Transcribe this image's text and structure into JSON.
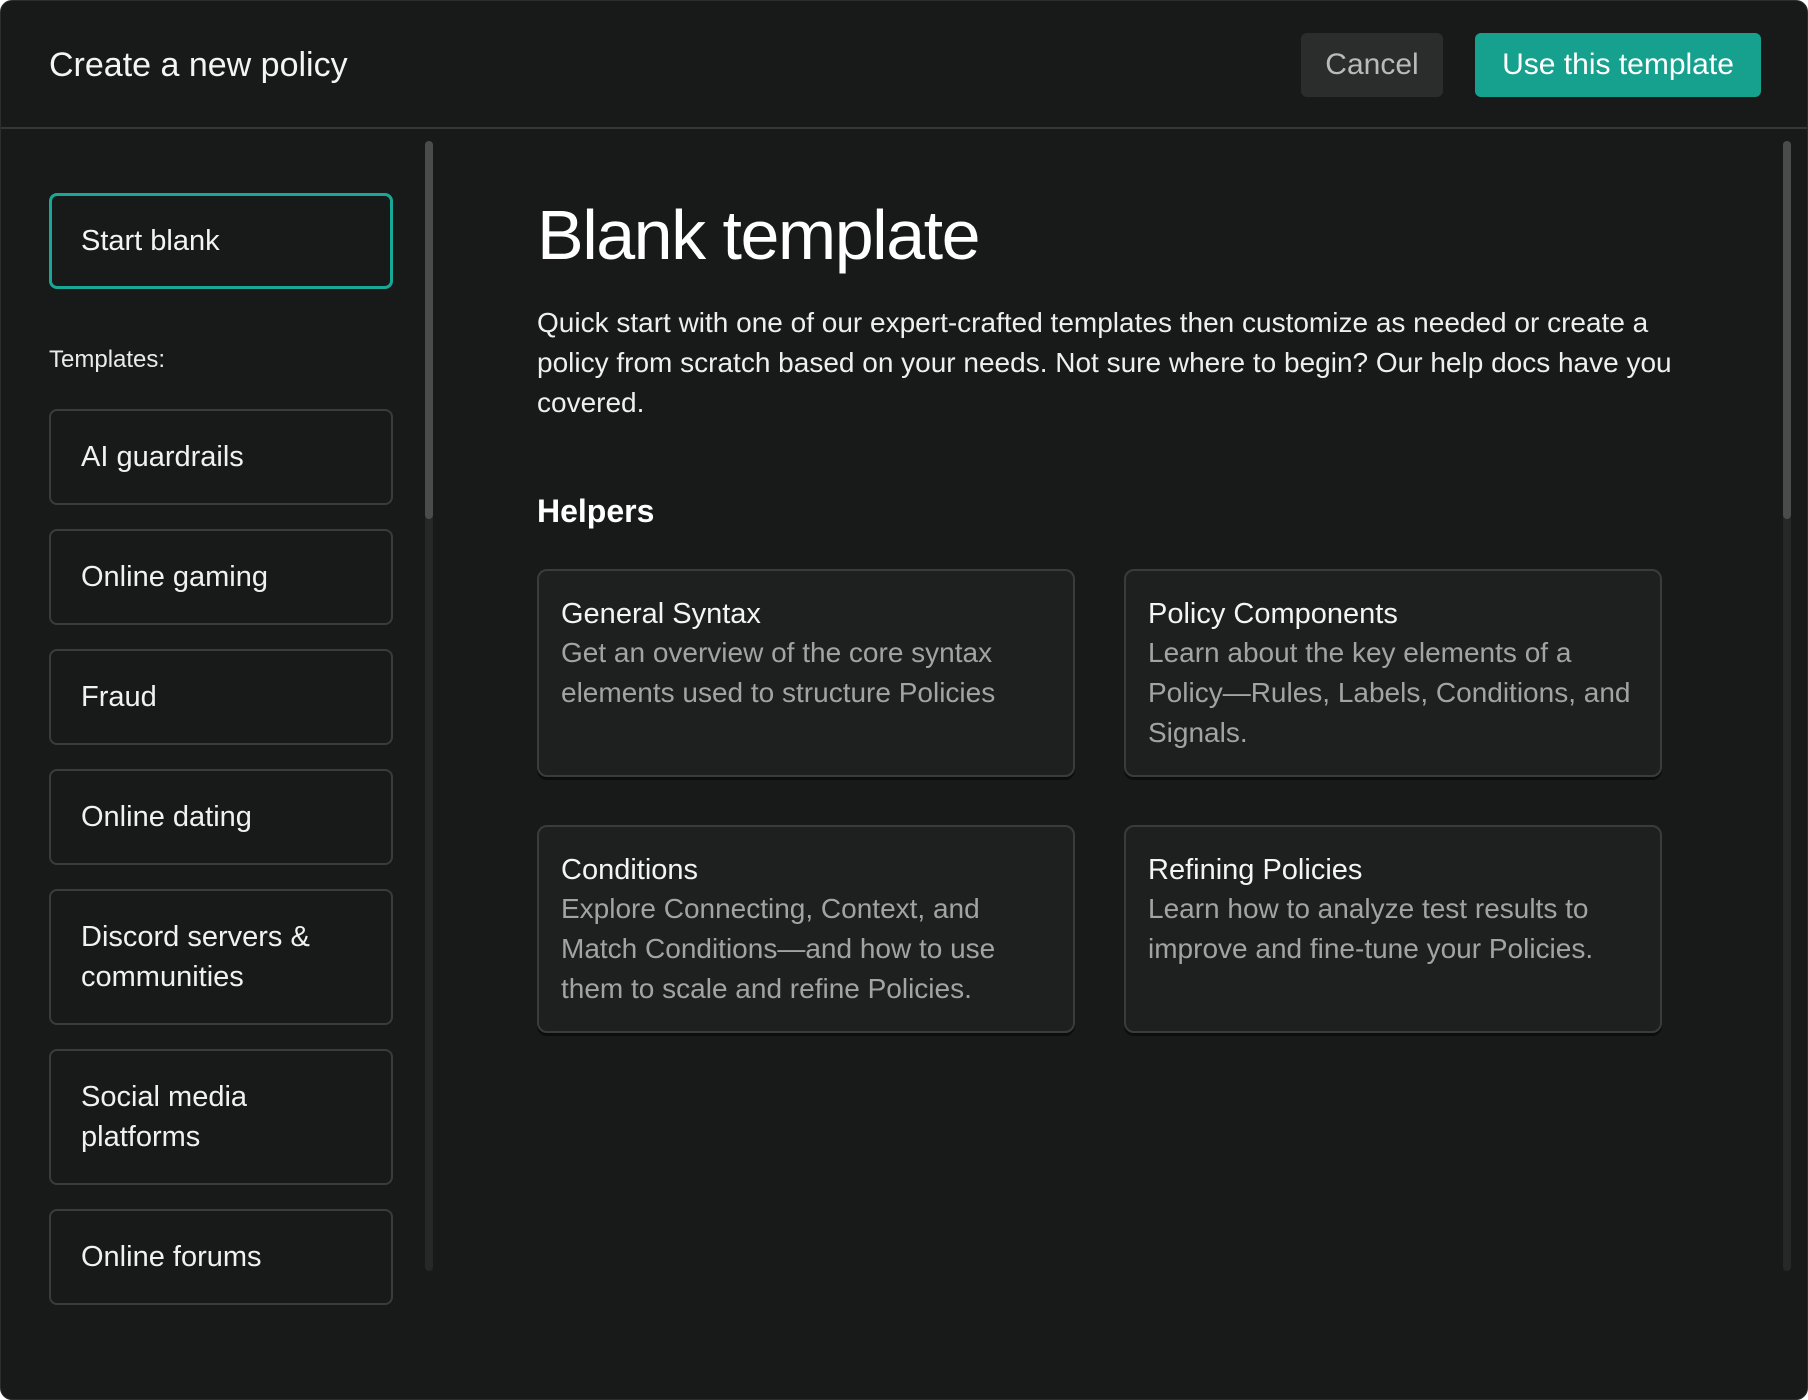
{
  "header": {
    "title": "Create a new policy",
    "cancel_label": "Cancel",
    "primary_label": "Use this template"
  },
  "sidebar": {
    "start_blank_label": "Start blank",
    "templates_label": "Templates:",
    "items": [
      {
        "label": "AI guardrails"
      },
      {
        "label": "Online gaming"
      },
      {
        "label": "Fraud"
      },
      {
        "label": "Online dating"
      },
      {
        "label": "Discord servers & communities"
      },
      {
        "label": "Social media platforms"
      },
      {
        "label": "Online forums"
      }
    ]
  },
  "main": {
    "title": "Blank template",
    "description": "Quick start with one of our expert-crafted templates then customize as needed or create a policy from scratch based on your needs. Not sure where to begin? Our help docs have you covered.",
    "helpers_heading": "Helpers",
    "helpers": [
      {
        "title": "General Syntax",
        "description": "Get an overview of the core syntax elements used to structure Policies"
      },
      {
        "title": "Policy Components",
        "description": "Learn about the key elements of a Policy—Rules, Labels, Conditions, and Signals."
      },
      {
        "title": "Conditions",
        "description": "Explore Connecting, Context, and Match Conditions—and how to use them to scale and refine Policies."
      },
      {
        "title": "Refining Policies",
        "description": "Learn how to analyze test results to improve and fine-tune your Policies."
      }
    ]
  },
  "colors": {
    "background": "#181a19",
    "accent": "#16a18f",
    "selected_border": "#17a896",
    "card_border": "#3a3c3b",
    "muted_text": "#a1a4a3"
  }
}
